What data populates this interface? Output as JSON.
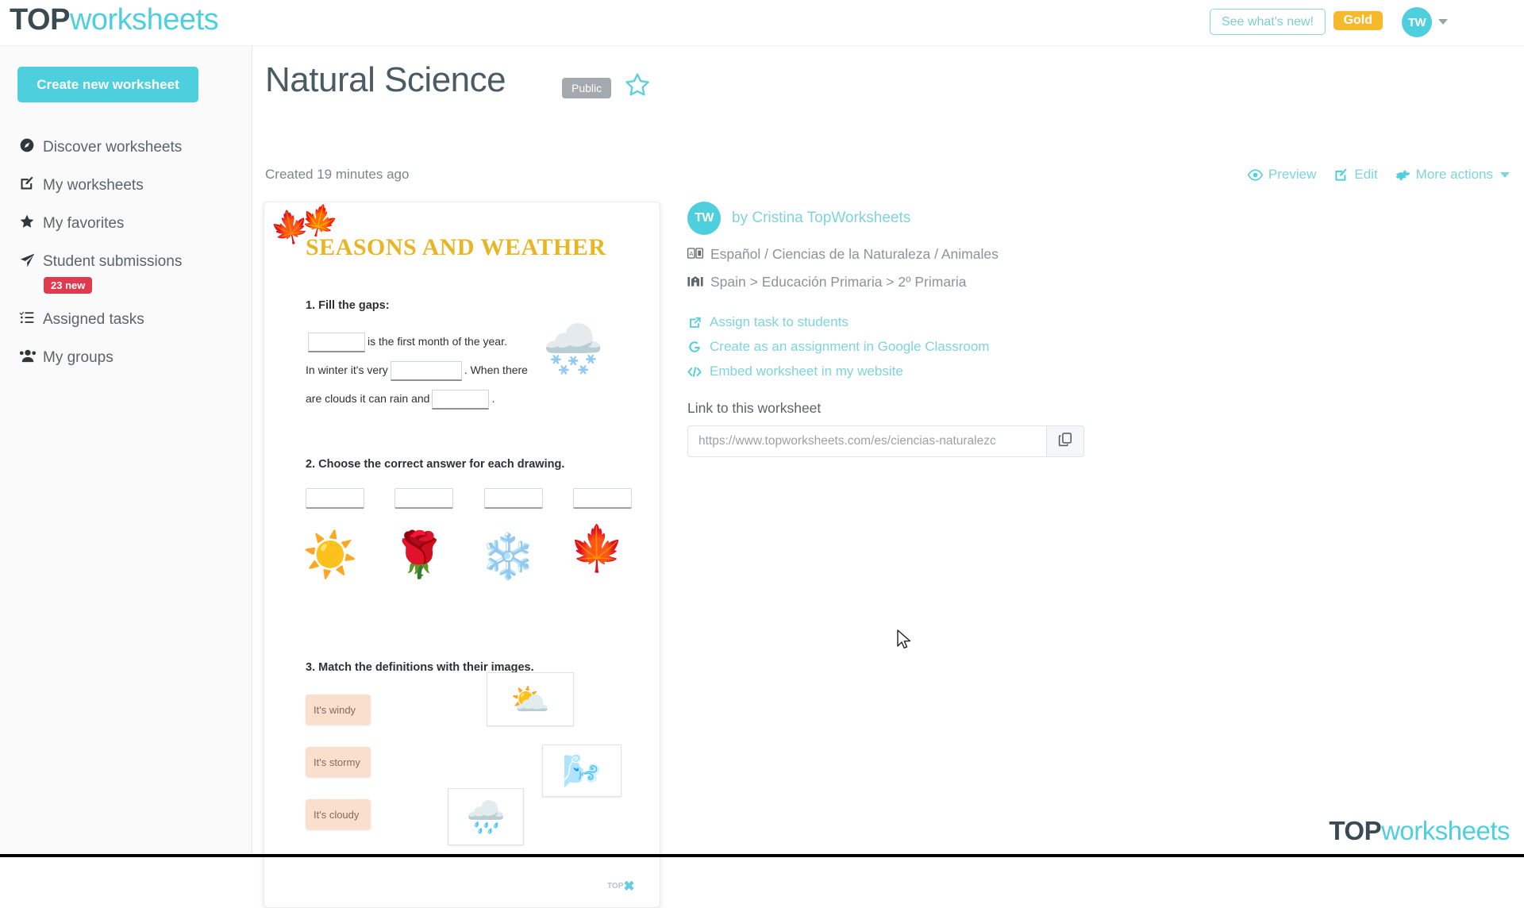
{
  "header": {
    "logo_top": "TOP",
    "logo_rest": "worksheets",
    "see_whats_new": "See what's new!",
    "gold_badge": "Gold",
    "avatar_initials": "TW",
    "accent_color": "#4ecfdd",
    "gold_color": "#f6b92c"
  },
  "sidebar": {
    "create_button": "Create new worksheet",
    "items": [
      {
        "label": "Discover worksheets",
        "icon": "compass-icon",
        "badge": null
      },
      {
        "label": "My worksheets",
        "icon": "edit-square-icon",
        "badge": null
      },
      {
        "label": "My favorites",
        "icon": "star-filled-icon",
        "badge": null
      },
      {
        "label": "Student submissions",
        "icon": "paper-plane-icon",
        "badge": "23 new"
      },
      {
        "label": "Assigned tasks",
        "icon": "task-list-icon",
        "badge": null
      },
      {
        "label": "My groups",
        "icon": "people-group-icon",
        "badge": null
      }
    ],
    "badge_color": "#e03a4e"
  },
  "main": {
    "title": "Natural Science",
    "visibility_badge": "Public",
    "created_text": "Created 19 minutes ago",
    "actions": [
      {
        "label": "Preview",
        "icon": "eye-icon"
      },
      {
        "label": "Edit",
        "icon": "edit-square-icon"
      },
      {
        "label": "More actions",
        "icon": "gear-icon"
      }
    ]
  },
  "info": {
    "author_avatar": "TW",
    "author_line": "by Cristina TopWorksheets",
    "meta": [
      {
        "icon": "language-icon",
        "text": "Español / Ciencias de la Naturaleza / Animales"
      },
      {
        "icon": "school-building-icon",
        "text": "Spain > Educación Primaria > 2º Primaria"
      }
    ],
    "links": [
      {
        "icon": "external-link-icon",
        "text": "Assign task to students"
      },
      {
        "icon": "google-g-icon",
        "text": "Create as an assignment in Google Classroom"
      },
      {
        "icon": "code-tags-icon",
        "text": "Embed worksheet in my website"
      }
    ],
    "link_label": "Link to this worksheet",
    "url_value": "https://www.topworksheets.com/es/ciencias-naturalezc",
    "copy_icon": "copy-icon"
  },
  "worksheet": {
    "title": "SEASONS AND WEATHER",
    "q1": {
      "heading": "1. Fill the gaps:",
      "line1_after": "is the first month  of the year.",
      "line2_before": "In winter it's very",
      "line2_after": ". When there",
      "line3_before": "are clouds it can rain and",
      "line3_after": ".",
      "image": "cloud-snow-icon"
    },
    "q2": {
      "heading": "2. Choose the correct answer for each drawing.",
      "images": [
        "sun-icon",
        "rose-icon",
        "snowflake-icon",
        "maple-leaf-icon"
      ],
      "answer_boxes": 4
    },
    "q3": {
      "heading": "3. Match the definitions with their images.",
      "definitions": [
        "It's windy",
        "It's stormy",
        "It's cloudy"
      ],
      "images": [
        "sun-behind-cloud-icon",
        "wind-cloud-icon",
        "rain-cloud-icon"
      ]
    },
    "footer_mark": "TOP"
  },
  "watermark": {
    "logo_top": "TOP",
    "logo_rest": "worksheets"
  }
}
